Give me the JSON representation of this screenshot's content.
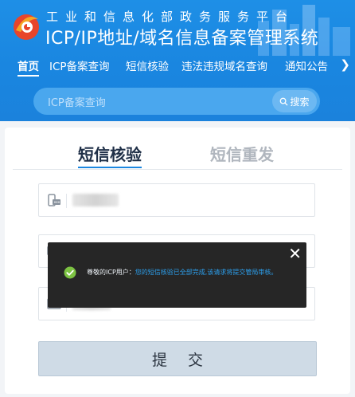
{
  "header": {
    "subtitle": "工业和信息化部政务服务平台",
    "title": "ICP/IP地址/域名信息备案管理系统"
  },
  "nav": {
    "items": [
      {
        "label": "首页",
        "active": true
      },
      {
        "label": "ICP备案查询",
        "active": false
      },
      {
        "label": "短信核验",
        "active": false
      },
      {
        "label": "违法违规域名查询",
        "active": false
      },
      {
        "label": "通知公告",
        "active": false
      }
    ],
    "more_icon": "chevron-right-icon"
  },
  "search": {
    "placeholder": "ICP备案查询",
    "button_label": "搜索",
    "button_icon": "search-icon"
  },
  "tabs": {
    "active": "短信核验",
    "inactive": "短信重发"
  },
  "form": {
    "fields": [
      {
        "icon": "phone-icon"
      },
      {
        "icon": "message-icon"
      },
      {
        "icon": "id-card-icon"
      }
    ],
    "submit_label": "提交"
  },
  "toast": {
    "prefix": "尊敬的ICP用户：",
    "message": "您的短信核验已全部完成,该请求将提交管局审核。",
    "close_icon": "close-icon",
    "status_icon": "check-circle-icon"
  },
  "colors": {
    "brand": "#1a86e0",
    "toast_bg": "#262626",
    "toast_message": "#2ca0ee",
    "success": "#7cc242"
  }
}
